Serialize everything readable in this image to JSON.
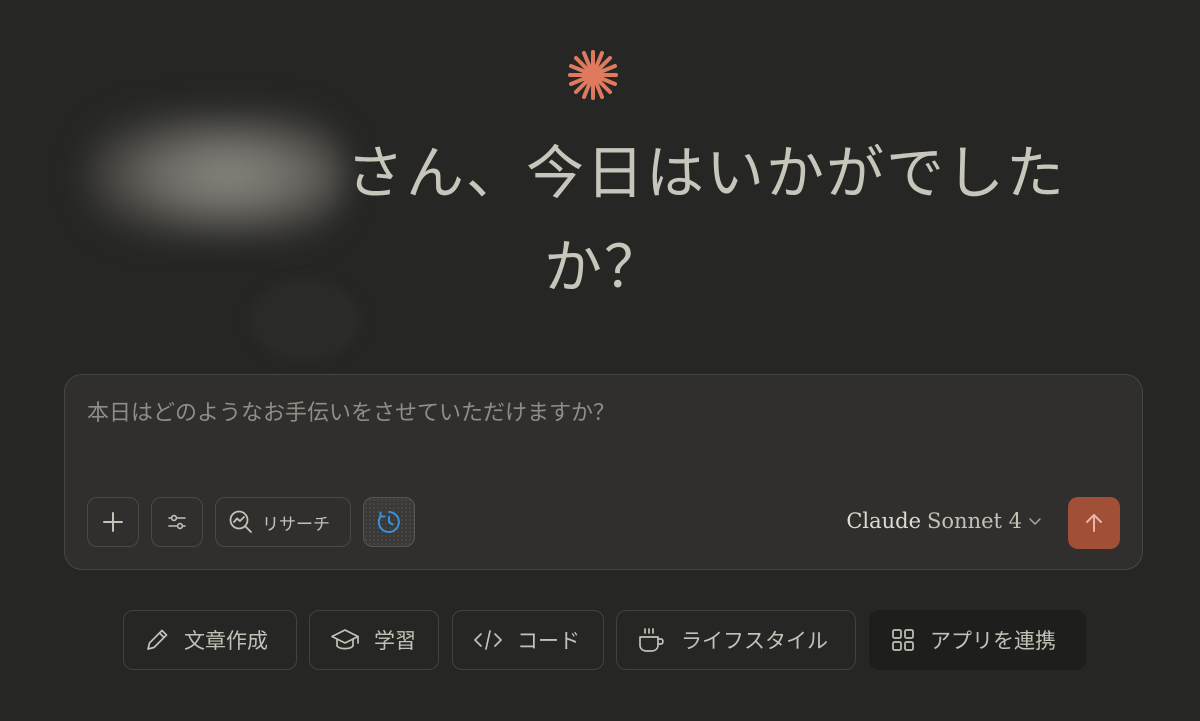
{
  "greeting": {
    "line1": "さん、今日はいかがでした",
    "line2": "か？"
  },
  "composer": {
    "placeholder": "本日はどのようなお手伝いをさせていただけますか？",
    "research_label": "リサーチ",
    "model_brand": "Claude",
    "model_variant": "Sonnet 4"
  },
  "chips": [
    {
      "label": "文章作成",
      "icon": "pencil-icon"
    },
    {
      "label": "学習",
      "icon": "graduation-cap-icon"
    },
    {
      "label": "コード",
      "icon": "code-icon"
    },
    {
      "label": "ライフスタイル",
      "icon": "coffee-cup-icon"
    },
    {
      "label": "アプリを連携",
      "icon": "grid-icon"
    }
  ],
  "colors": {
    "background": "#262624",
    "accent": "#d97757",
    "send_button": "#a24f37",
    "extended_thinking": "#3b8fd9"
  }
}
